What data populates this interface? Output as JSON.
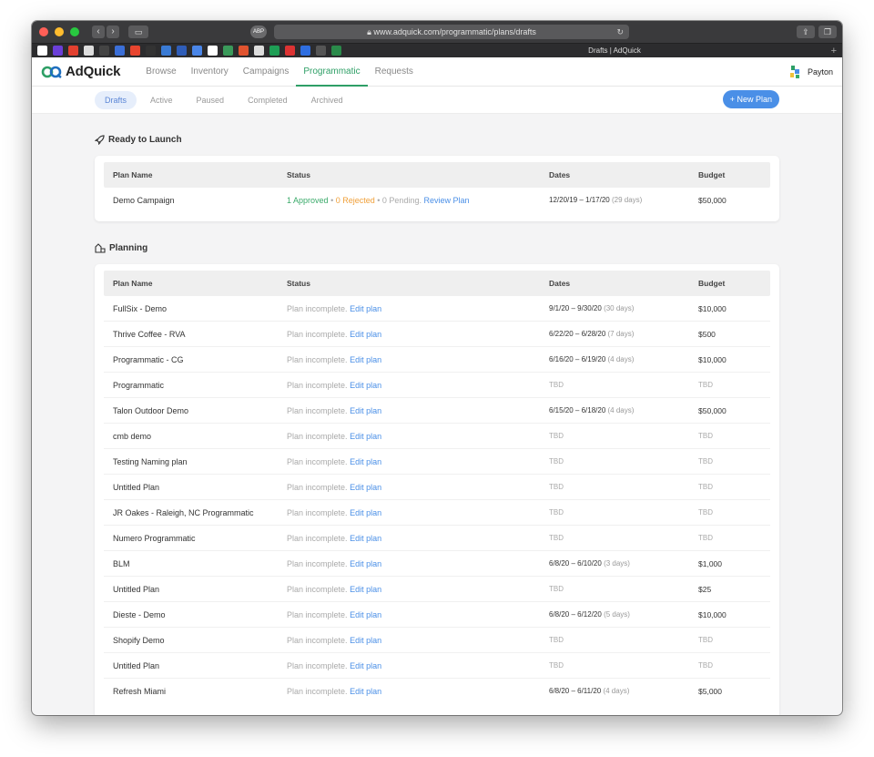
{
  "browser": {
    "url": "www.adquick.com/programmatic/plans/drafts",
    "tab_title": "Drafts | AdQuick",
    "ext_label": "ABP"
  },
  "header": {
    "brand": "AdQuick",
    "nav": [
      "Browse",
      "Inventory",
      "Campaigns",
      "Programmatic",
      "Requests"
    ],
    "active_nav": "Programmatic",
    "user_name": "Payton"
  },
  "subnav": {
    "tabs": [
      "Drafts",
      "Active",
      "Paused",
      "Completed",
      "Archived"
    ],
    "active_tab": "Drafts",
    "new_plan_label": "New Plan"
  },
  "columns": {
    "name": "Plan Name",
    "status": "Status",
    "dates": "Dates",
    "budget": "Budget"
  },
  "ready": {
    "title": "Ready to Launch",
    "rows": [
      {
        "name": "Demo Campaign",
        "approved": "1 Approved",
        "rejected": "0 Rejected",
        "pending": "0 Pending.",
        "review_link": "Review Plan",
        "dates": "12/20/19 – 1/17/20",
        "duration": "(29 days)",
        "budget": "$50,000"
      }
    ]
  },
  "planning": {
    "title": "Planning",
    "status_text": "Plan incomplete.",
    "edit_link": "Edit plan",
    "rows": [
      {
        "name": "FullSix - Demo",
        "dates": "9/1/20 – 9/30/20",
        "duration": "(30 days)",
        "budget": "$10,000"
      },
      {
        "name": "Thrive Coffee - RVA",
        "dates": "6/22/20 – 6/28/20",
        "duration": "(7 days)",
        "budget": "$500"
      },
      {
        "name": "Programmatic - CG",
        "dates": "6/16/20 – 6/19/20",
        "duration": "(4 days)",
        "budget": "$10,000"
      },
      {
        "name": "Programmatic",
        "dates": "TBD",
        "duration": "",
        "budget": "TBD"
      },
      {
        "name": "Talon Outdoor Demo",
        "dates": "6/15/20 – 6/18/20",
        "duration": "(4 days)",
        "budget": "$50,000"
      },
      {
        "name": "cmb demo",
        "dates": "TBD",
        "duration": "",
        "budget": "TBD"
      },
      {
        "name": "Testing Naming plan",
        "dates": "TBD",
        "duration": "",
        "budget": "TBD"
      },
      {
        "name": "Untitled Plan",
        "dates": "TBD",
        "duration": "",
        "budget": "TBD"
      },
      {
        "name": "JR Oakes - Raleigh, NC Programmatic",
        "dates": "TBD",
        "duration": "",
        "budget": "TBD"
      },
      {
        "name": "Numero Programmatic",
        "dates": "TBD",
        "duration": "",
        "budget": "TBD"
      },
      {
        "name": "BLM",
        "dates": "6/8/20 – 6/10/20",
        "duration": "(3 days)",
        "budget": "$1,000"
      },
      {
        "name": "Untitled Plan",
        "dates": "TBD",
        "duration": "",
        "budget": "$25"
      },
      {
        "name": "Dieste - Demo",
        "dates": "6/8/20 – 6/12/20",
        "duration": "(5 days)",
        "budget": "$10,000"
      },
      {
        "name": "Shopify Demo",
        "dates": "TBD",
        "duration": "",
        "budget": "TBD"
      },
      {
        "name": "Untitled Plan",
        "dates": "TBD",
        "duration": "",
        "budget": "TBD"
      },
      {
        "name": "Refresh Miami",
        "dates": "6/8/20 – 6/11/20",
        "duration": "(4 days)",
        "budget": "$5,000"
      }
    ]
  },
  "colors": {
    "accent_green": "#2e9f66",
    "accent_blue": "#4a8fe7",
    "approved": "#3aaa6a",
    "rejected": "#f0a03a"
  }
}
